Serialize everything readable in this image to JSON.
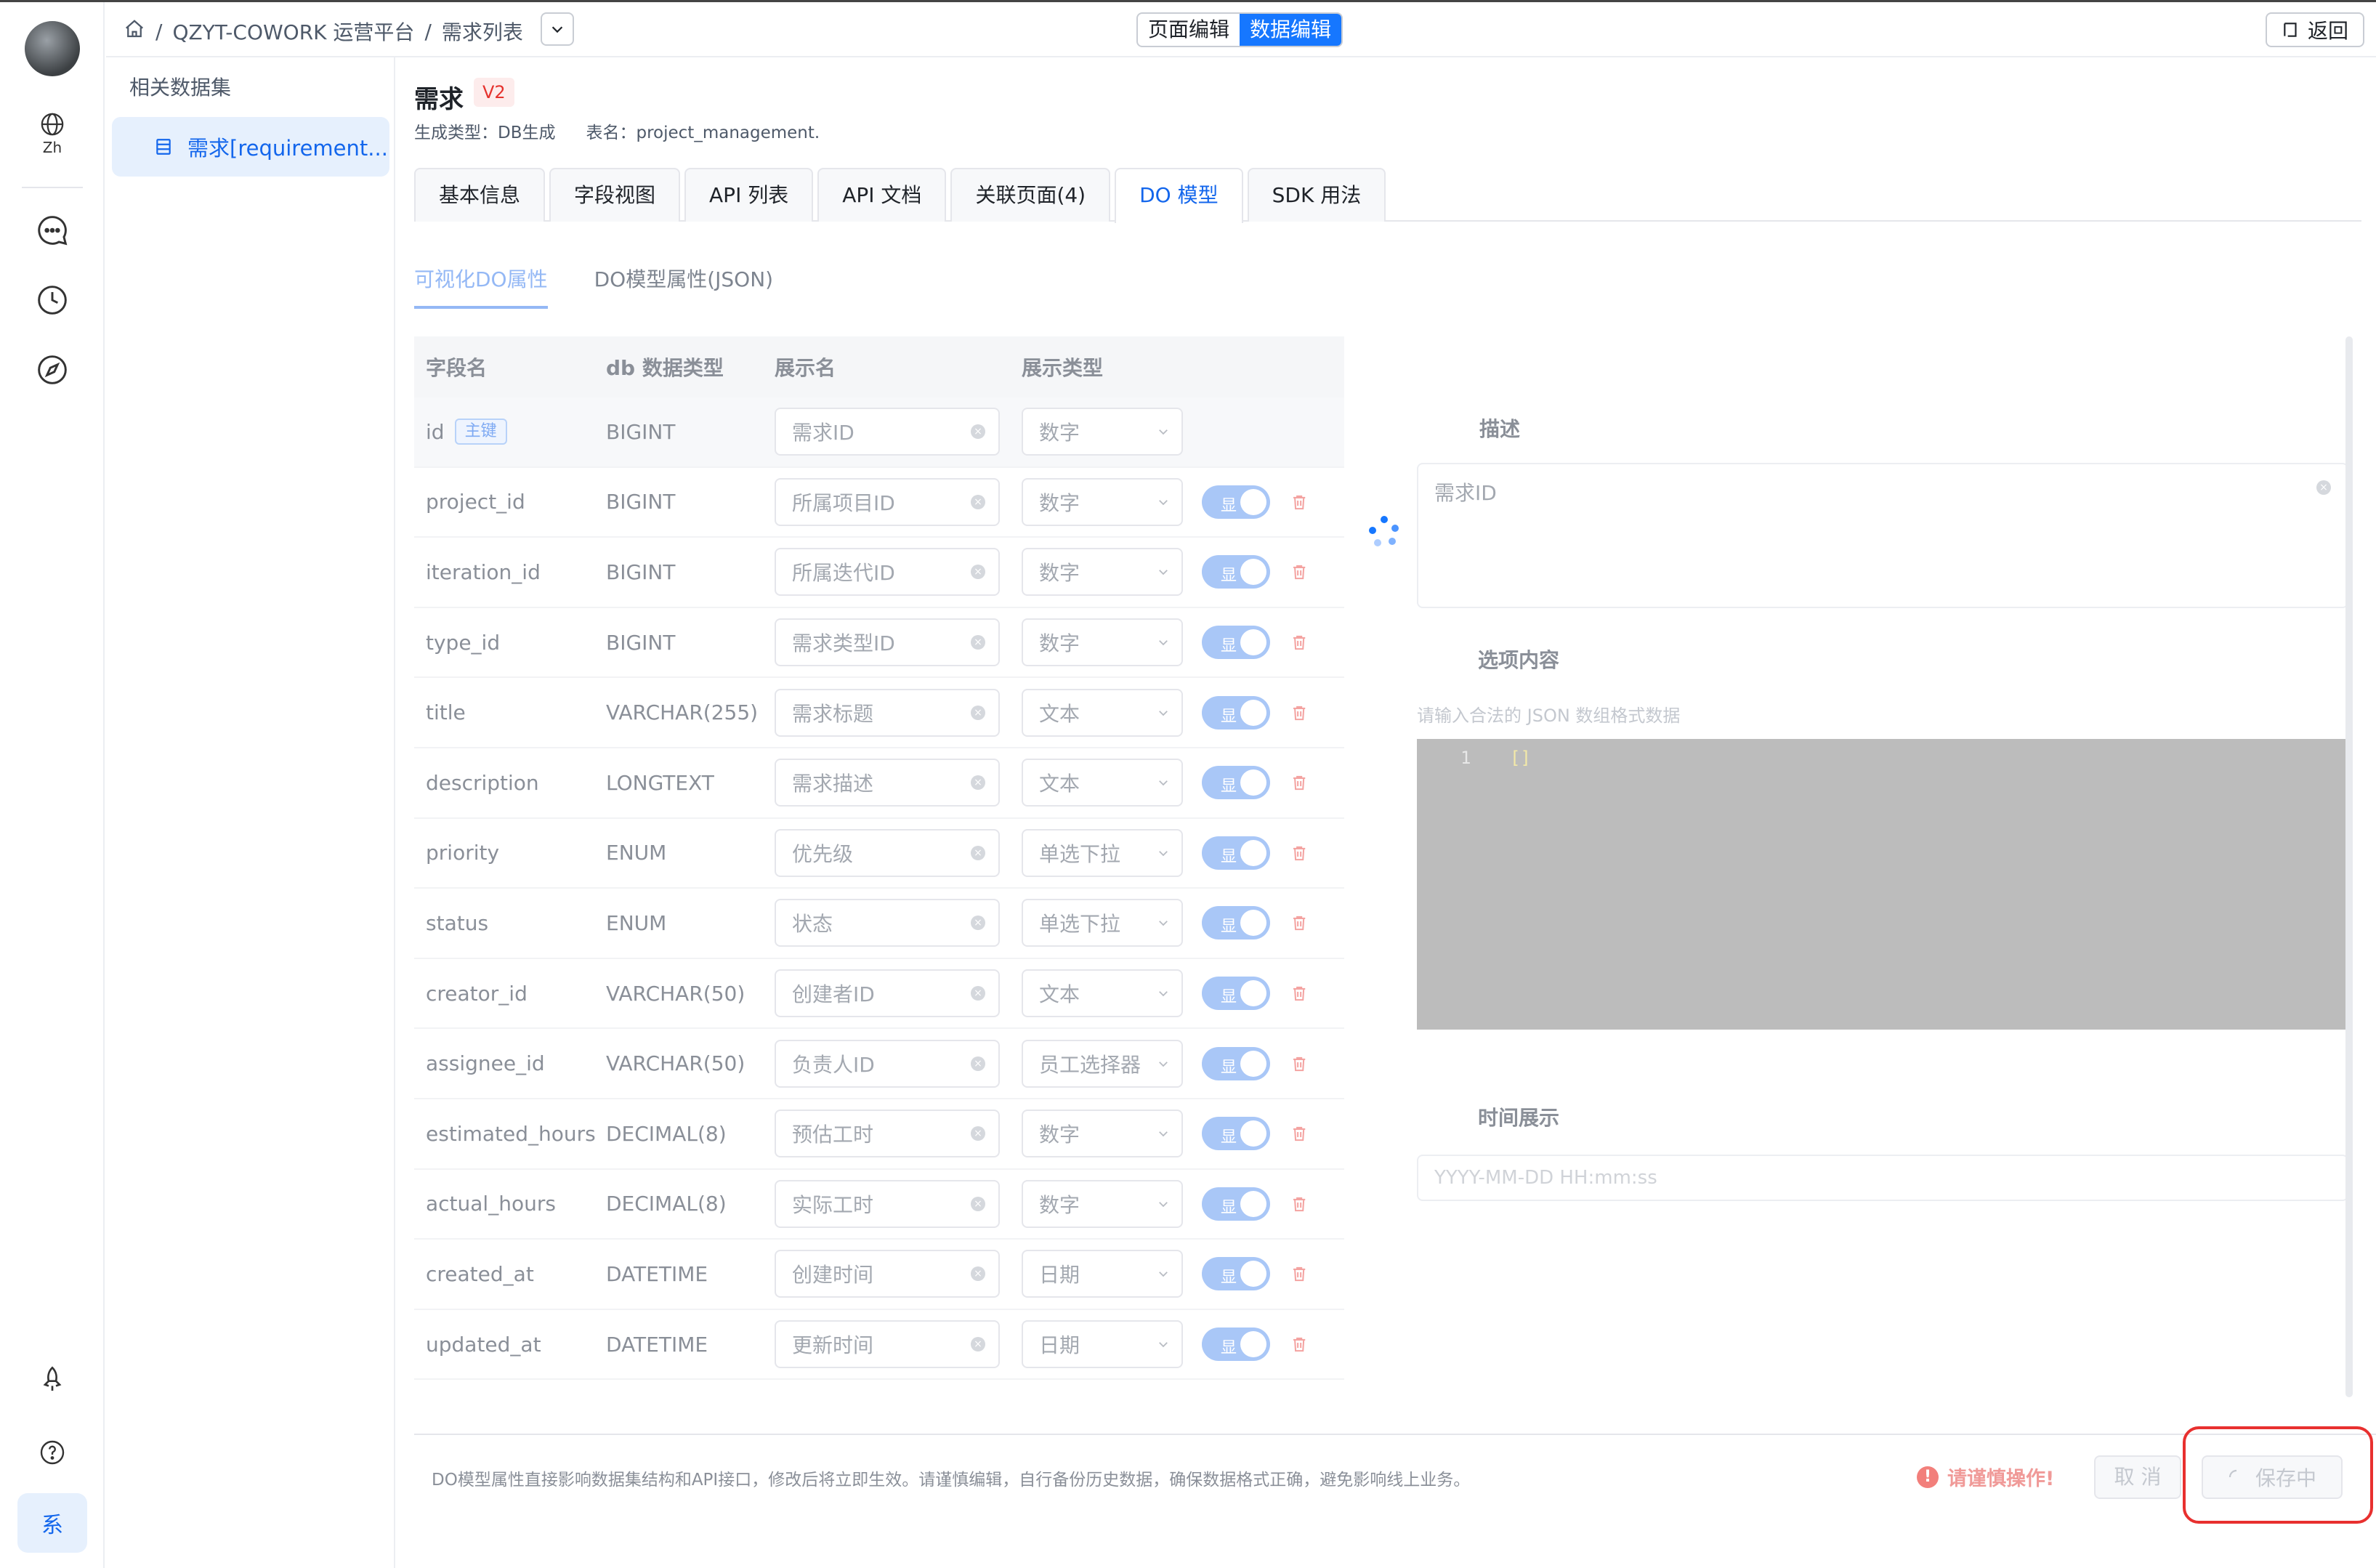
{
  "rail": {
    "lang": "Zh",
    "bottom_label": "系"
  },
  "topbar": {
    "crumbs": [
      "QZYT-COWORK 运营平台",
      "需求列表"
    ],
    "crumb_sep": "/",
    "mode_page": "页面编辑",
    "mode_data": "数据编辑",
    "back": "返回"
  },
  "datasets": {
    "title": "相关数据集",
    "items": [
      "需求[requirement..."
    ]
  },
  "header": {
    "title": "需求",
    "version": "V2",
    "gen_type": "生成类型：DB生成",
    "table_name": "表名：project_management."
  },
  "tabs": [
    "基本信息",
    "字段视图",
    "API 列表",
    "API 文档",
    "关联页面(4)",
    "DO 模型",
    "SDK 用法"
  ],
  "subtabs": [
    "可视化DO属性",
    "DO模型属性(JSON)"
  ],
  "table": {
    "headers": [
      "字段名",
      "db 数据类型",
      "展示名",
      "展示类型"
    ],
    "pk_label": "主键",
    "switch_label": "显",
    "rows": [
      {
        "field": "id",
        "db": "BIGINT",
        "display": "需求ID",
        "type": "数字"
      },
      {
        "field": "project_id",
        "db": "BIGINT",
        "display": "所属项目ID",
        "type": "数字"
      },
      {
        "field": "iteration_id",
        "db": "BIGINT",
        "display": "所属迭代ID",
        "type": "数字"
      },
      {
        "field": "type_id",
        "db": "BIGINT",
        "display": "需求类型ID",
        "type": "数字"
      },
      {
        "field": "title",
        "db": "VARCHAR(255)",
        "display": "需求标题",
        "type": "文本"
      },
      {
        "field": "description",
        "db": "LONGTEXT",
        "display": "需求描述",
        "type": "文本"
      },
      {
        "field": "priority",
        "db": "ENUM",
        "display": "优先级",
        "type": "单选下拉"
      },
      {
        "field": "status",
        "db": "ENUM",
        "display": "状态",
        "type": "单选下拉"
      },
      {
        "field": "creator_id",
        "db": "VARCHAR(50)",
        "display": "创建者ID",
        "type": "文本"
      },
      {
        "field": "assignee_id",
        "db": "VARCHAR(50)",
        "display": "负责人ID",
        "type": "员工选择器"
      },
      {
        "field": "estimated_hours",
        "db": "DECIMAL(8)",
        "display": "预估工时",
        "type": "数字"
      },
      {
        "field": "actual_hours",
        "db": "DECIMAL(8)",
        "display": "实际工时",
        "type": "数字"
      },
      {
        "field": "created_at",
        "db": "DATETIME",
        "display": "创建时间",
        "type": "日期"
      },
      {
        "field": "updated_at",
        "db": "DATETIME",
        "display": "更新时间",
        "type": "日期"
      }
    ]
  },
  "panel": {
    "desc_label": "描述",
    "desc_value": "需求ID",
    "options_label": "选项内容",
    "options_hint": "请输入合法的 JSON 数组格式数据",
    "editor_line": "1",
    "editor_code": "[]",
    "time_label": "时间展示",
    "time_placeholder": "YYYY-MM-DD HH:mm:ss"
  },
  "footer": {
    "note": "DO模型属性直接影响数据集结构和API接口，修改后将立即生效。请谨慎编辑，自行备份历史数据，确保数据格式正确，避免影响线上业务。",
    "warning": "请谨慎操作!",
    "warning_icon": "!",
    "cancel": "取 消",
    "save": "保存中"
  },
  "colors": {
    "accent": "#1677ff",
    "danger": "#e8302f"
  }
}
